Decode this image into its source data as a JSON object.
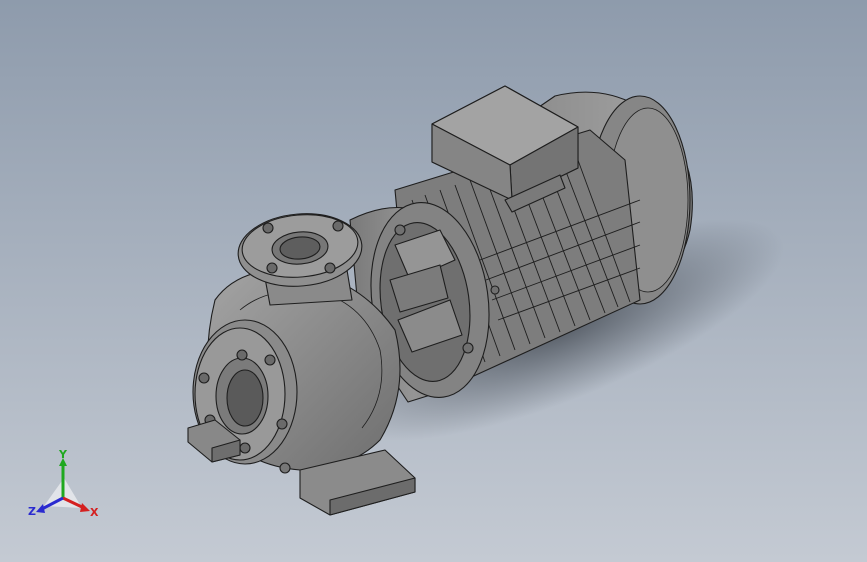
{
  "viewport": {
    "background_top": "#8e9bac",
    "background_bottom": "#c4cad3",
    "model": {
      "name": "pump-motor-assembly",
      "body_color": "#8a8a8a",
      "edge_color": "#1e1e1e"
    }
  },
  "triad": {
    "x_label": "X",
    "y_label": "Y",
    "z_label": "Z",
    "x_color": "#d42020",
    "y_color": "#1fa81f",
    "z_color": "#2a2ad0"
  }
}
